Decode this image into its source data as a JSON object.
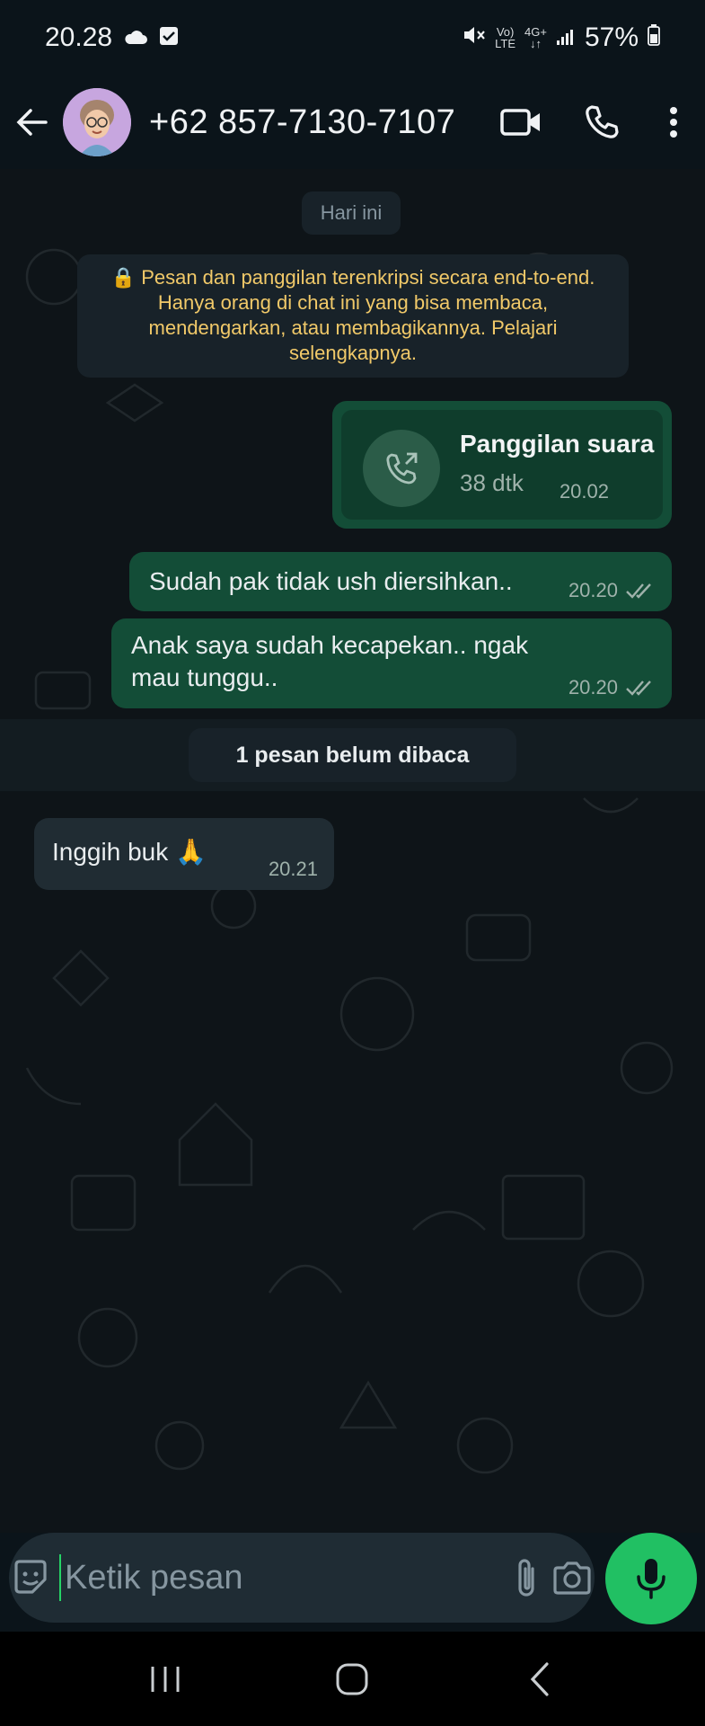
{
  "status_bar": {
    "time": "20.28",
    "signal_label_top": "Vo)",
    "signal_label_bottom": "LTE",
    "network_top": "4G+",
    "battery": "57%"
  },
  "header": {
    "contact": "+62 857-7130-7107"
  },
  "chat": {
    "date_chip": "Hari ini",
    "encryption_notice": "🔒 Pesan dan panggilan terenkripsi secara end-to-end. Hanya orang di chat ini yang bisa membaca, mendengarkan, atau membagikannya. Pelajari selengkapnya.",
    "call": {
      "title": "Panggilan suara",
      "duration": "38 dtk",
      "time": "20.02"
    },
    "messages_out": [
      {
        "text": "Sudah pak tidak ush diersihkan..",
        "time": "20.20"
      },
      {
        "text": "Anak saya sudah kecapekan.. ngak mau tunggu..",
        "time": "20.20"
      }
    ],
    "unread_label": "1 pesan belum dibaca",
    "messages_in": [
      {
        "text": "Inggih buk 🙏",
        "time": "20.21"
      }
    ]
  },
  "input": {
    "placeholder": "Ketik pesan"
  },
  "colors": {
    "accent": "#21c063",
    "bubble_out": "#134d37",
    "bubble_in": "#202c33",
    "notice_text": "#f1c969"
  }
}
